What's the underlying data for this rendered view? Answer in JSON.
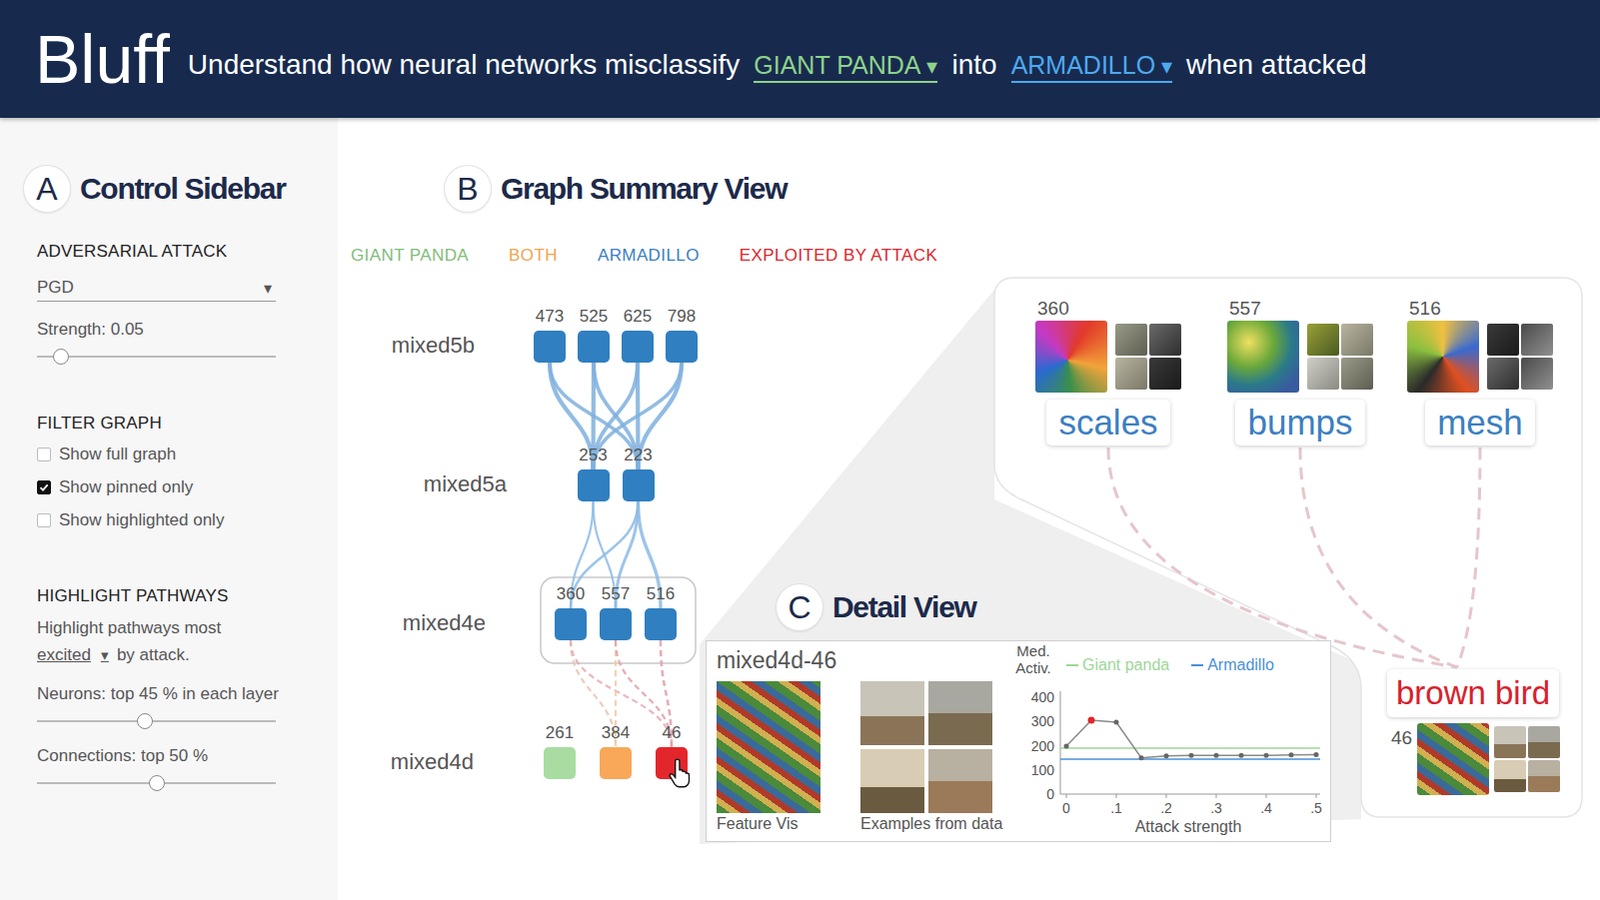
{
  "dropdown_icon": "▾",
  "header": {
    "logo": "Bluff",
    "lead": "Understand how neural networks misclassify",
    "source_class": {
      "label": "GIANT PANDA",
      "color": "#8ed28a"
    },
    "joiner": "into",
    "target_class": {
      "label": "ARMADILLO",
      "color": "#4ea9ee"
    },
    "tail": "when attacked"
  },
  "sidebar": {
    "badge": "A",
    "title": "Control Sidebar",
    "attack": {
      "heading": "ADVERSARIAL ATTACK",
      "method": "PGD",
      "strength_label": "Strength: 0.05",
      "strength_level": 0.1
    },
    "filter": {
      "heading": "FILTER GRAPH",
      "options": [
        {
          "label": "Show full graph",
          "checked": false
        },
        {
          "label": "Show pinned only",
          "checked": true
        },
        {
          "label": "Show highlighted only",
          "checked": false
        }
      ]
    },
    "highlight": {
      "heading": "HIGHLIGHT PATHWAYS",
      "lead": "Highlight pathways most",
      "mode": "excited",
      "tail": "by attack.",
      "sliders": [
        {
          "label": "Neurons: top 45 % in each layer",
          "level": 0.45
        },
        {
          "label": "Connections: top 50 %",
          "level": 0.5
        }
      ]
    }
  },
  "graph": {
    "badge": "B",
    "title": "Graph Summary View",
    "legend": [
      {
        "label": "GIANT PANDA",
        "color": "#7fbd7a"
      },
      {
        "label": "BOTH",
        "color": "#f2a450"
      },
      {
        "label": "ARMADILLO",
        "color": "#3b7fc2"
      },
      {
        "label": "EXPLOITED BY ATTACK",
        "color": "#e0262c"
      }
    ],
    "layers": [
      {
        "name": "mixed5b",
        "neurons": [
          {
            "number": "473",
            "color": "#2f7fc1",
            "pinned": false,
            "selected": false
          },
          {
            "number": "525",
            "color": "#2f7fc1",
            "pinned": false,
            "selected": false
          },
          {
            "number": "625",
            "color": "#2f7fc1",
            "pinned": false,
            "selected": false
          },
          {
            "number": "798",
            "color": "#2f7fc1",
            "pinned": false,
            "selected": false
          }
        ]
      },
      {
        "name": "mixed5a",
        "neurons": [
          {
            "number": "253",
            "color": "#2f7fc1",
            "pinned": false,
            "selected": false
          },
          {
            "number": "223",
            "color": "#2f7fc1",
            "pinned": false,
            "selected": false
          }
        ]
      },
      {
        "name": "mixed4e",
        "neurons": [
          {
            "number": "360",
            "color": "#2f7fc1",
            "pinned": true,
            "selected": false
          },
          {
            "number": "557",
            "color": "#2f7fc1",
            "pinned": true,
            "selected": false
          },
          {
            "number": "516",
            "color": "#2f7fc1",
            "pinned": true,
            "selected": false
          }
        ]
      },
      {
        "name": "mixed4d",
        "neurons": [
          {
            "number": "261",
            "color": "#a8dca0",
            "pinned": false,
            "selected": false
          },
          {
            "number": "384",
            "color": "#f8a858",
            "pinned": false,
            "selected": false
          },
          {
            "number": "46",
            "color": "#e3262b",
            "pinned": false,
            "selected": true
          }
        ]
      }
    ],
    "edges": [
      {
        "from": "473",
        "to": "253",
        "color": "#7fb0de",
        "dashed": false,
        "weight": 0.8
      },
      {
        "from": "473",
        "to": "223",
        "color": "#7fb0de",
        "dashed": false,
        "weight": 0.6
      },
      {
        "from": "525",
        "to": "253",
        "color": "#7fb0de",
        "dashed": false,
        "weight": 0.8
      },
      {
        "from": "525",
        "to": "223",
        "color": "#7fb0de",
        "dashed": false,
        "weight": 0.7
      },
      {
        "from": "625",
        "to": "253",
        "color": "#7fb0de",
        "dashed": false,
        "weight": 0.7
      },
      {
        "from": "625",
        "to": "223",
        "color": "#7fb0de",
        "dashed": false,
        "weight": 0.8
      },
      {
        "from": "798",
        "to": "253",
        "color": "#7fb0de",
        "dashed": false,
        "weight": 0.6
      },
      {
        "from": "798",
        "to": "223",
        "color": "#7fb0de",
        "dashed": false,
        "weight": 0.8
      },
      {
        "from": "253",
        "to": "360",
        "color": "#8dbbe4",
        "dashed": false,
        "weight": 0.3
      },
      {
        "from": "253",
        "to": "557",
        "color": "#8dbbe4",
        "dashed": false,
        "weight": 0.3
      },
      {
        "from": "223",
        "to": "360",
        "color": "#8dbbe4",
        "dashed": false,
        "weight": 0.4
      },
      {
        "from": "223",
        "to": "557",
        "color": "#8dbbe4",
        "dashed": false,
        "weight": 0.5
      },
      {
        "from": "223",
        "to": "516",
        "color": "#8dbbe4",
        "dashed": false,
        "weight": 0.6
      },
      {
        "from": "360",
        "to": "384",
        "color": "#e8c4b4",
        "dashed": true,
        "weight": 0.3
      },
      {
        "from": "360",
        "to": "46",
        "color": "#e6aab2",
        "dashed": true,
        "weight": 0.3
      },
      {
        "from": "557",
        "to": "384",
        "color": "#f0caa4",
        "dashed": true,
        "weight": 0.3
      },
      {
        "from": "557",
        "to": "46",
        "color": "#e0a0a8",
        "dashed": true,
        "weight": 0.3
      },
      {
        "from": "516",
        "to": "46",
        "color": "#e0a0a8",
        "dashed": true,
        "weight": 0.4
      }
    ]
  },
  "zoom": {
    "features": [
      {
        "number": "360",
        "label": "scales",
        "color": "#3b7fc2"
      },
      {
        "number": "557",
        "label": "bumps",
        "color": "#3b7fc2"
      },
      {
        "number": "516",
        "label": "mesh",
        "color": "#3b7fc2"
      }
    ],
    "target": {
      "number": "46",
      "label": "brown bird",
      "color": "#d9202a"
    }
  },
  "detail": {
    "badge": "C",
    "title": "Detail View",
    "neuron": "mixed4d-46",
    "captions": [
      "Feature Vis",
      "Examples from data"
    ],
    "chart": {
      "y_label": "Med. Activ.",
      "x_label": "Attack strength",
      "y_ticks": [
        "400",
        "300",
        "200",
        "100",
        "0"
      ],
      "x_ticks": [
        "0",
        ".1",
        ".2",
        ".3",
        ".4",
        ".5"
      ],
      "x_values": [
        0,
        0.05,
        0.1,
        0.15,
        0.2,
        0.25,
        0.3,
        0.35,
        0.4,
        0.45,
        0.5
      ],
      "values": [
        198,
        305,
        297,
        150,
        158,
        160,
        160,
        160,
        160,
        162,
        163
      ],
      "highlight_index": 1,
      "reference_lines": [
        {
          "label": "Giant panda",
          "value": 190,
          "color": "#9ed69a"
        },
        {
          "label": "Armadillo",
          "value": 144,
          "color": "#4a90d9"
        }
      ]
    }
  }
}
